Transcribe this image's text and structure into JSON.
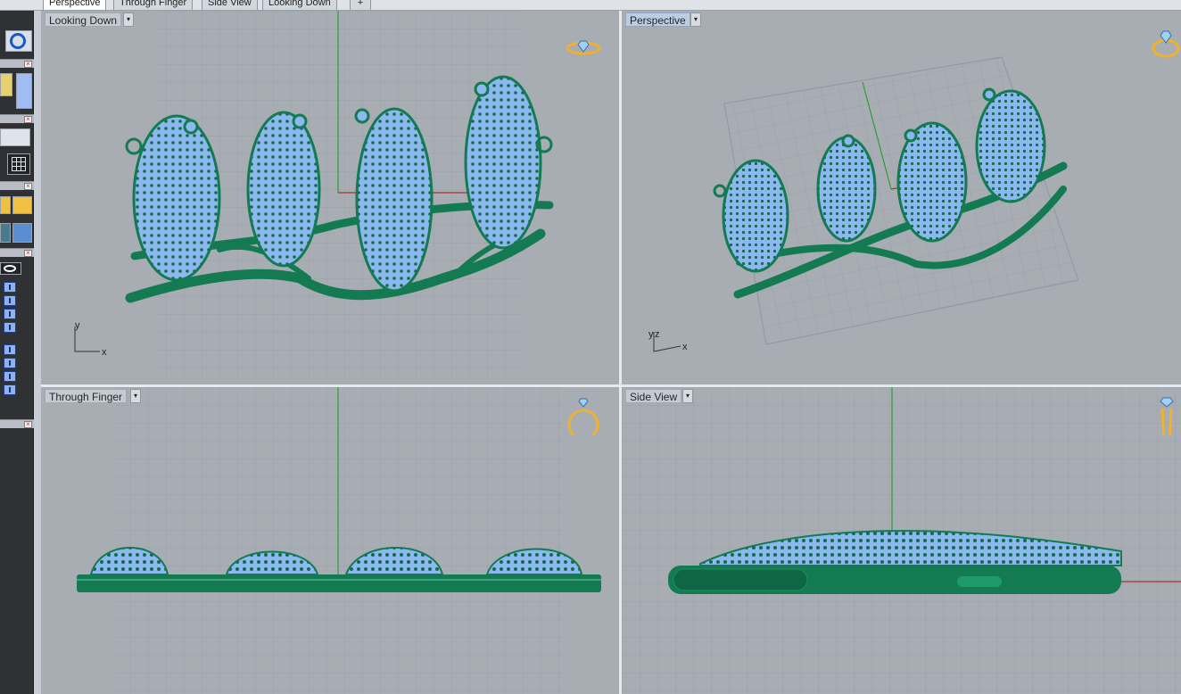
{
  "tabs": [
    {
      "label": "Perspective"
    },
    {
      "label": "Through Finger"
    },
    {
      "label": "Side View"
    },
    {
      "label": "Looking Down"
    }
  ],
  "viewports": {
    "top_left": {
      "label": "Looking Down",
      "axis_x": "x",
      "axis_y": "y"
    },
    "top_right": {
      "label": "Perspective",
      "axis_x": "x",
      "axis_y": "y",
      "axis_z": "z"
    },
    "bottom_left": {
      "label": "Through Finger"
    },
    "bottom_right": {
      "label": "Side View"
    }
  },
  "icons": {
    "add_tab": "plus-icon",
    "view_menu": "dropdown-arrow-icon",
    "view_indicator": "ring-view-icon"
  },
  "colors": {
    "model_green": "#137a52",
    "gem_blue": "#8cb8f0",
    "viewport_bg": "#a8adb4",
    "grid_line": "#97a0a9",
    "axis_green": "#30a030",
    "axis_red": "#b03030",
    "ring_gold": "#f0b030"
  }
}
